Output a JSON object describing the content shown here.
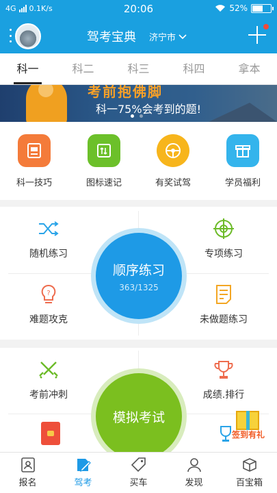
{
  "status_bar": {
    "network": "4G",
    "speed": "0.1K/s",
    "time": "20:06",
    "battery": "52%"
  },
  "header": {
    "title": "驾考宝典",
    "city": "济宁市",
    "accent_color": "#1aa0e0"
  },
  "tabs": [
    "科一",
    "科二",
    "科三",
    "科四",
    "拿本"
  ],
  "banner": {
    "headline": "考前抱佛脚",
    "subtitle": "科一75%会考到的题!"
  },
  "quick_links": [
    {
      "label": "科一技巧",
      "icon": "document-icon",
      "color": "#f47b3a"
    },
    {
      "label": "图标速记",
      "icon": "sign-icon",
      "color": "#6cc02a"
    },
    {
      "label": "有奖试驾",
      "icon": "steering-icon",
      "color": "#f7b51c"
    },
    {
      "label": "学员福利",
      "icon": "gift-icon",
      "color": "#34b4ec"
    }
  ],
  "practice": {
    "main_label": "顺序练习",
    "progress": "363/1325",
    "items": [
      {
        "label": "随机练习",
        "icon": "shuffle-icon"
      },
      {
        "label": "专项练习",
        "icon": "target-icon"
      },
      {
        "label": "难题攻克",
        "icon": "bulb-icon"
      },
      {
        "label": "未做题练习",
        "icon": "notes-icon"
      }
    ]
  },
  "exam": {
    "main_label": "模拟考试",
    "items": [
      {
        "label": "考前冲刺",
        "icon": "swords-icon"
      },
      {
        "label": "成绩.排行",
        "icon": "trophy-icon"
      }
    ],
    "gift_badge": "签到有礼"
  },
  "bottom_nav": [
    {
      "label": "报名",
      "icon": "id-card-icon"
    },
    {
      "label": "驾考",
      "icon": "edit-icon"
    },
    {
      "label": "买车",
      "icon": "tag-icon"
    },
    {
      "label": "发现",
      "icon": "person-icon"
    },
    {
      "label": "百宝箱",
      "icon": "box-icon"
    }
  ]
}
